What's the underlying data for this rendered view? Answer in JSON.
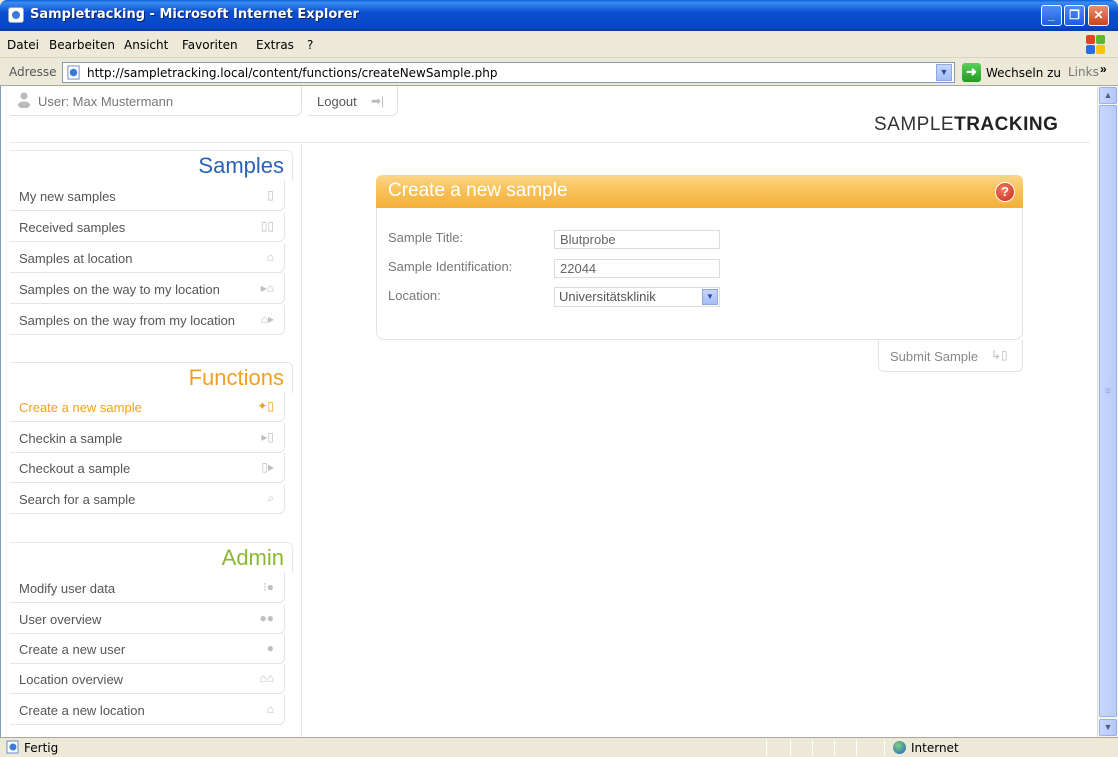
{
  "window": {
    "title": "Sampletracking - Microsoft Internet Explorer",
    "min_glyph": "_",
    "max_glyph": "❐",
    "close_glyph": "✕"
  },
  "menu": [
    "Datei",
    "Bearbeiten",
    "Ansicht",
    "Favoriten",
    "Extras",
    "?"
  ],
  "address": {
    "label": "Adresse",
    "url": "http://sampletracking.local/content/functions/createNewSample.php",
    "go_label": "Wechseln zu",
    "links_label": "Links",
    "dropdown_glyph": "▼",
    "links_more_glyph": "»"
  },
  "status": {
    "text": "Fertig",
    "zone": "Internet"
  },
  "header": {
    "user_label": "User:  Max Mustermann",
    "logout_label": "Logout",
    "logout_icon": "➡|",
    "brand_light": "SAMPLE",
    "brand_bold": "TRACKING"
  },
  "sidebar": {
    "samples": {
      "title": "Samples",
      "color": "#2a62b8",
      "items": [
        {
          "label": "My new samples",
          "icon": "tube-icon",
          "glyph": "▯"
        },
        {
          "label": "Received samples",
          "icon": "two-tubes-icon",
          "glyph": "▯▯"
        },
        {
          "label": "Samples at location",
          "icon": "house-dots-icon",
          "glyph": "⌂"
        },
        {
          "label": "Samples on the way to my location",
          "icon": "arrow-to-house-icon",
          "glyph": "▸⌂"
        },
        {
          "label": "Samples on the way from my location",
          "icon": "arrow-from-house-icon",
          "glyph": "⌂▸"
        }
      ]
    },
    "functions": {
      "title": "Functions",
      "color": "#f0a020",
      "items": [
        {
          "label": "Create a new sample",
          "icon": "new-sample-icon",
          "glyph": "✦▯",
          "active": true
        },
        {
          "label": "Checkin a sample",
          "icon": "checkin-icon",
          "glyph": "▸▯"
        },
        {
          "label": "Checkout a sample",
          "icon": "checkout-icon",
          "glyph": "▯▸"
        },
        {
          "label": "Search for a sample",
          "icon": "search-icon",
          "glyph": "⌕"
        }
      ]
    },
    "admin": {
      "title": "Admin",
      "color": "#8ab832",
      "items": [
        {
          "label": "Modify user data",
          "icon": "modify-user-icon",
          "glyph": "⁝●"
        },
        {
          "label": "User overview",
          "icon": "users-icon",
          "glyph": "●●"
        },
        {
          "label": "Create a new user",
          "icon": "new-user-icon",
          "glyph": "●"
        },
        {
          "label": "Location overview",
          "icon": "locations-icon",
          "glyph": "⌂⌂"
        },
        {
          "label": "Create a new location",
          "icon": "new-location-icon",
          "glyph": "⌂"
        }
      ]
    }
  },
  "form": {
    "title": "Create a new sample",
    "help_glyph": "?",
    "fields": {
      "title_label": "Sample Title:",
      "title_value": "Blutprobe",
      "id_label": "Sample Identification:",
      "id_value": "22044",
      "location_label": "Location:",
      "location_value": "Universitätsklinik",
      "select_glyph": "▼"
    },
    "submit_label": "Submit Sample",
    "submit_icon": "↳▯"
  },
  "scrollbar": {
    "up_glyph": "▲",
    "down_glyph": "▼"
  }
}
